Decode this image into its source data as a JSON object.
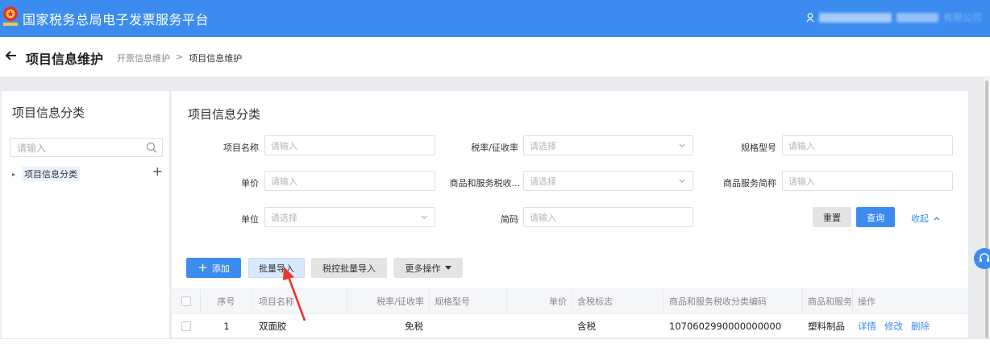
{
  "header": {
    "app_title": "国家税务总局电子发票服务平台",
    "user_suffix": "有限公司"
  },
  "page": {
    "title": "项目信息维护",
    "breadcrumb": [
      "开票信息维护",
      "项目信息维护"
    ],
    "breadcrumb_sep": ">"
  },
  "sidebar": {
    "title": "项目信息分类",
    "search_placeholder": "请输入",
    "tree_node": "项目信息分类",
    "add_symbol": "+"
  },
  "main": {
    "title": "项目信息分类",
    "filters": {
      "name_label": "项目名称",
      "name_placeholder": "请输入",
      "tax_label": "税率/征收率",
      "tax_placeholder": "请选择",
      "spec_label": "规格型号",
      "spec_placeholder": "请输入",
      "price_label": "单价",
      "price_placeholder": "请输入",
      "code_label": "商品和服务税收...",
      "code_placeholder": "请选择",
      "short_label": "商品服务简称",
      "short_placeholder": "请输入",
      "unit_label": "单位",
      "unit_placeholder": "请选择",
      "abbr_label": "简码",
      "abbr_placeholder": "请输入"
    },
    "buttons": {
      "reset": "重置",
      "query": "查询",
      "collapse": "收起",
      "add": "添加",
      "batch_import": "批量导入",
      "tax_batch_import": "税控批量导入",
      "more": "更多操作"
    },
    "table": {
      "headers": [
        "序号",
        "项目名称",
        "税率/征收率",
        "规格型号",
        "单价",
        "含税标志",
        "商品和服务税收分类编码",
        "商品和服务",
        "操作"
      ],
      "rows": [
        {
          "index": "1",
          "name": "双面胶",
          "tax": "免税",
          "spec": "",
          "price": "",
          "tax_flag": "含税",
          "code": "1070602990000000000",
          "category": "塑料制品",
          "actions": [
            "详情",
            "修改",
            "删除"
          ]
        }
      ]
    }
  },
  "colors": {
    "primary": "#3c8cf0",
    "arrow": "#e8352e"
  },
  "icons": {
    "emblem": "national-emblem-icon",
    "user": "user-icon",
    "back": "arrow-left-icon",
    "search": "search-icon",
    "chevron": "chevron-down-icon",
    "support": "headset-icon"
  }
}
